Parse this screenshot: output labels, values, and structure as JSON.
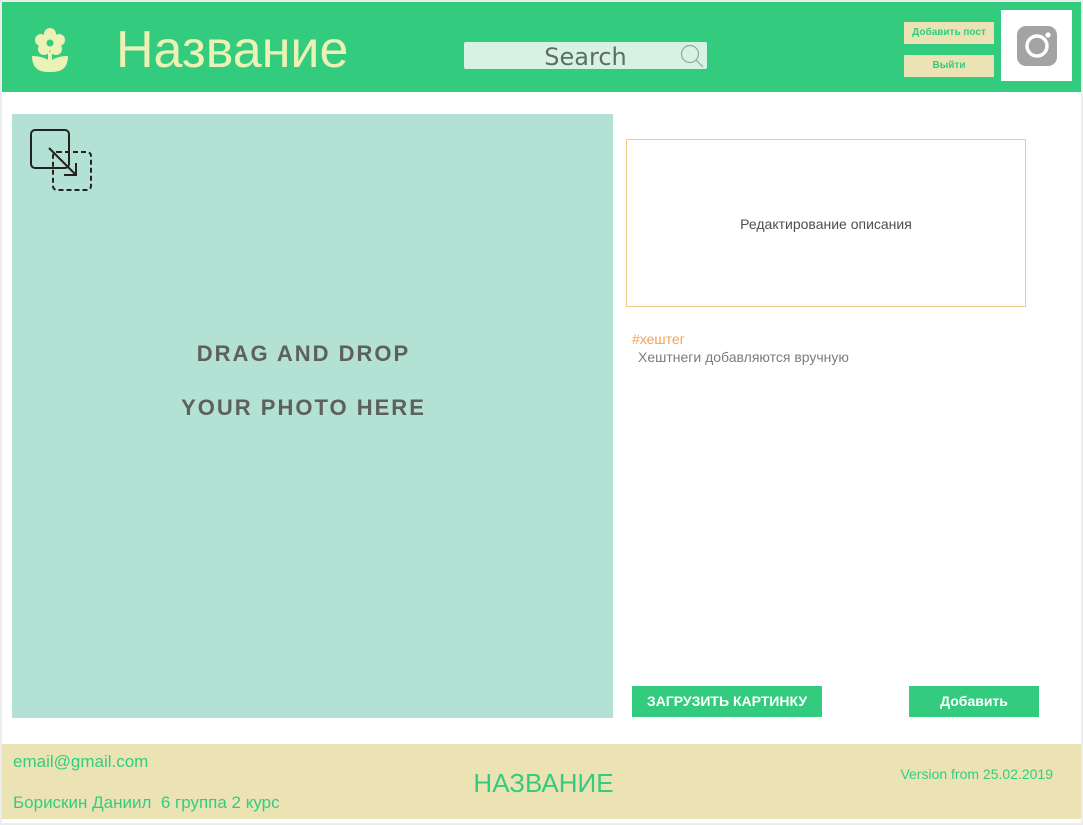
{
  "header": {
    "logo_icon": "flower-icon",
    "title": "Название",
    "search": {
      "placeholder": "Search",
      "icon": "search-icon"
    },
    "add_post_label": "Добавить пост",
    "logout_label": "Выйти",
    "avatar_icon": "camera-icon"
  },
  "dropzone": {
    "icon": "drag-drop-icon",
    "line1": "DRAG AND DROP",
    "line2": "YOUR PHOTO HERE"
  },
  "editor": {
    "description_placeholder": "Редактирование описания",
    "hashtag": "#хештег",
    "hashtag_hint": "Хештнеги добавляются вручную",
    "upload_label": "ЗАГРУЗИТЬ КАРТИНКУ",
    "add_label": "Добавить"
  },
  "footer": {
    "email": "email@gmail.com",
    "author": "Борискин Даниил  6 группа 2 курс",
    "name": "НАЗВАНИЕ",
    "version": "Version from 25.02.2019"
  },
  "colors": {
    "primary_green": "#33cc7f",
    "cream": "#ece3b5",
    "dropzone_bg": "#b3e2d5",
    "hashtag_orange": "#f2a257"
  }
}
